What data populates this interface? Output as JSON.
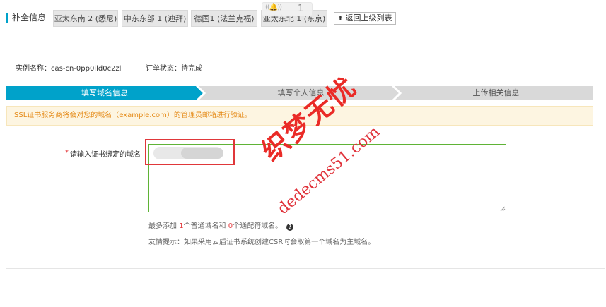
{
  "header": {
    "title": "补全信息",
    "region_tabs": [
      "亚太东南 2 (悉尼)",
      "中东东部 1 (迪拜)",
      "德国1 (法兰克福)",
      "亚太东北 1 (东京)"
    ],
    "back_button": "返回上级列表",
    "notification": {
      "icon": "bell-icon",
      "count": "1"
    }
  },
  "info": {
    "instance_label": "实例名称：",
    "instance_value": "cas-cn-0pp0ild0c2zl",
    "status_label": "订单状态：",
    "status_value": "待完成"
  },
  "steps": [
    {
      "label": "填写域名信息",
      "active": true
    },
    {
      "label": "填写个人信息",
      "active": false
    },
    {
      "label": "上传相关信息",
      "active": false
    }
  ],
  "notice": "SSL证书服务商将会对您的域名（example.com）的管理员邮箱进行验证。",
  "form": {
    "required_mark": "*",
    "domain_label": "请输入证书绑定的域名",
    "hint_prefix": "最多添加 ",
    "hint_count1": "1",
    "hint_mid": "个普通域名和 ",
    "hint_count2": "0",
    "hint_suffix": "个通配符域名。",
    "help_icon": "?",
    "tip": "友情提示：如果采用云盾证书系统创建CSR时会取第一个域名为主域名。"
  },
  "watermark": {
    "chinese": "织梦无忧",
    "url": "dedecms51.com"
  },
  "colors": {
    "accent": "#00a2ca",
    "step_inactive": "#d9d9d9",
    "notice_text": "#e58b19",
    "input_border": "#5fb336",
    "watermark": "#ea2b27"
  }
}
